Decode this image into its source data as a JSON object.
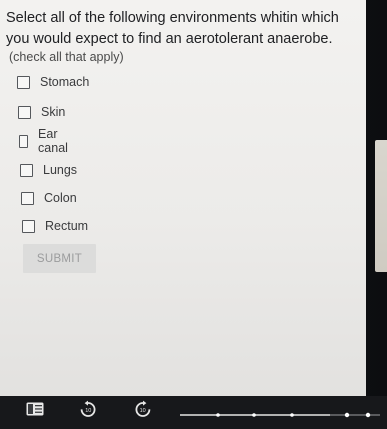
{
  "question": {
    "text": "Select all of the following environments whitin which you would expect to find an aerotolerant anaerobe.",
    "hint": "(check all that apply)"
  },
  "options": [
    {
      "label": "Stomach",
      "checked": false
    },
    {
      "label": "Skin",
      "checked": false
    },
    {
      "label": "Ear canal",
      "checked": false
    },
    {
      "label": "Lungs",
      "checked": false
    },
    {
      "label": "Colon",
      "checked": false
    },
    {
      "label": "Rectum",
      "checked": false
    }
  ],
  "submit": {
    "label": "SUBMIT",
    "enabled": false
  },
  "player": {
    "rewind_label": "10",
    "forward_label": "10"
  },
  "colors": {
    "background": "#f3f2f0",
    "text": "#202124",
    "button_disabled": "#dcdcdb"
  }
}
